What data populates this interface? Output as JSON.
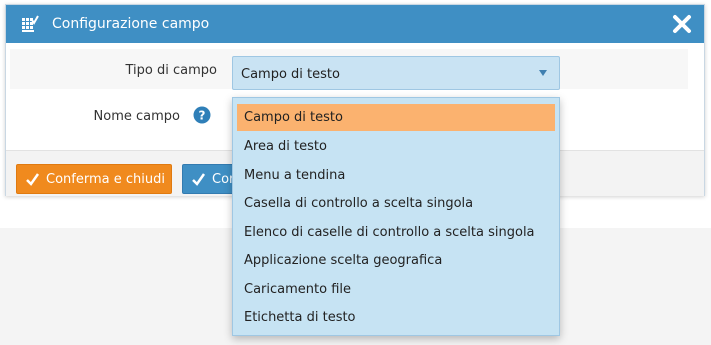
{
  "dialog": {
    "title": "Configurazione campo",
    "title_icon": "grid-check-icon",
    "close_icon": "close-icon"
  },
  "form": {
    "field_type_label": "Tipo di campo",
    "field_type_value": "Campo di testo",
    "field_name_label": "Nome campo",
    "help_icon": "question-circle-icon"
  },
  "dropdown": {
    "options": [
      {
        "label": "Campo di testo",
        "selected": true
      },
      {
        "label": "Area di testo",
        "selected": false
      },
      {
        "label": "Menu a tendina",
        "selected": false
      },
      {
        "label": "Casella di controllo a scelta singola",
        "selected": false
      },
      {
        "label": "Elenco di caselle di controllo a scelta singola",
        "selected": false
      },
      {
        "label": "Applicazione scelta geografica",
        "selected": false
      },
      {
        "label": "Caricamento file",
        "selected": false
      },
      {
        "label": "Etichetta di testo",
        "selected": false
      }
    ]
  },
  "footer": {
    "confirm_close_label": "Conferma e chiudi",
    "confirm_label_partial": "Con"
  },
  "colors": {
    "titlebar": "#3f8fc4",
    "select_bg": "#c9e3f3",
    "selected_option": "#fbb26f",
    "confirm_close_bg": "#f08a1e",
    "confirm_bg": "#3f8fc4"
  }
}
